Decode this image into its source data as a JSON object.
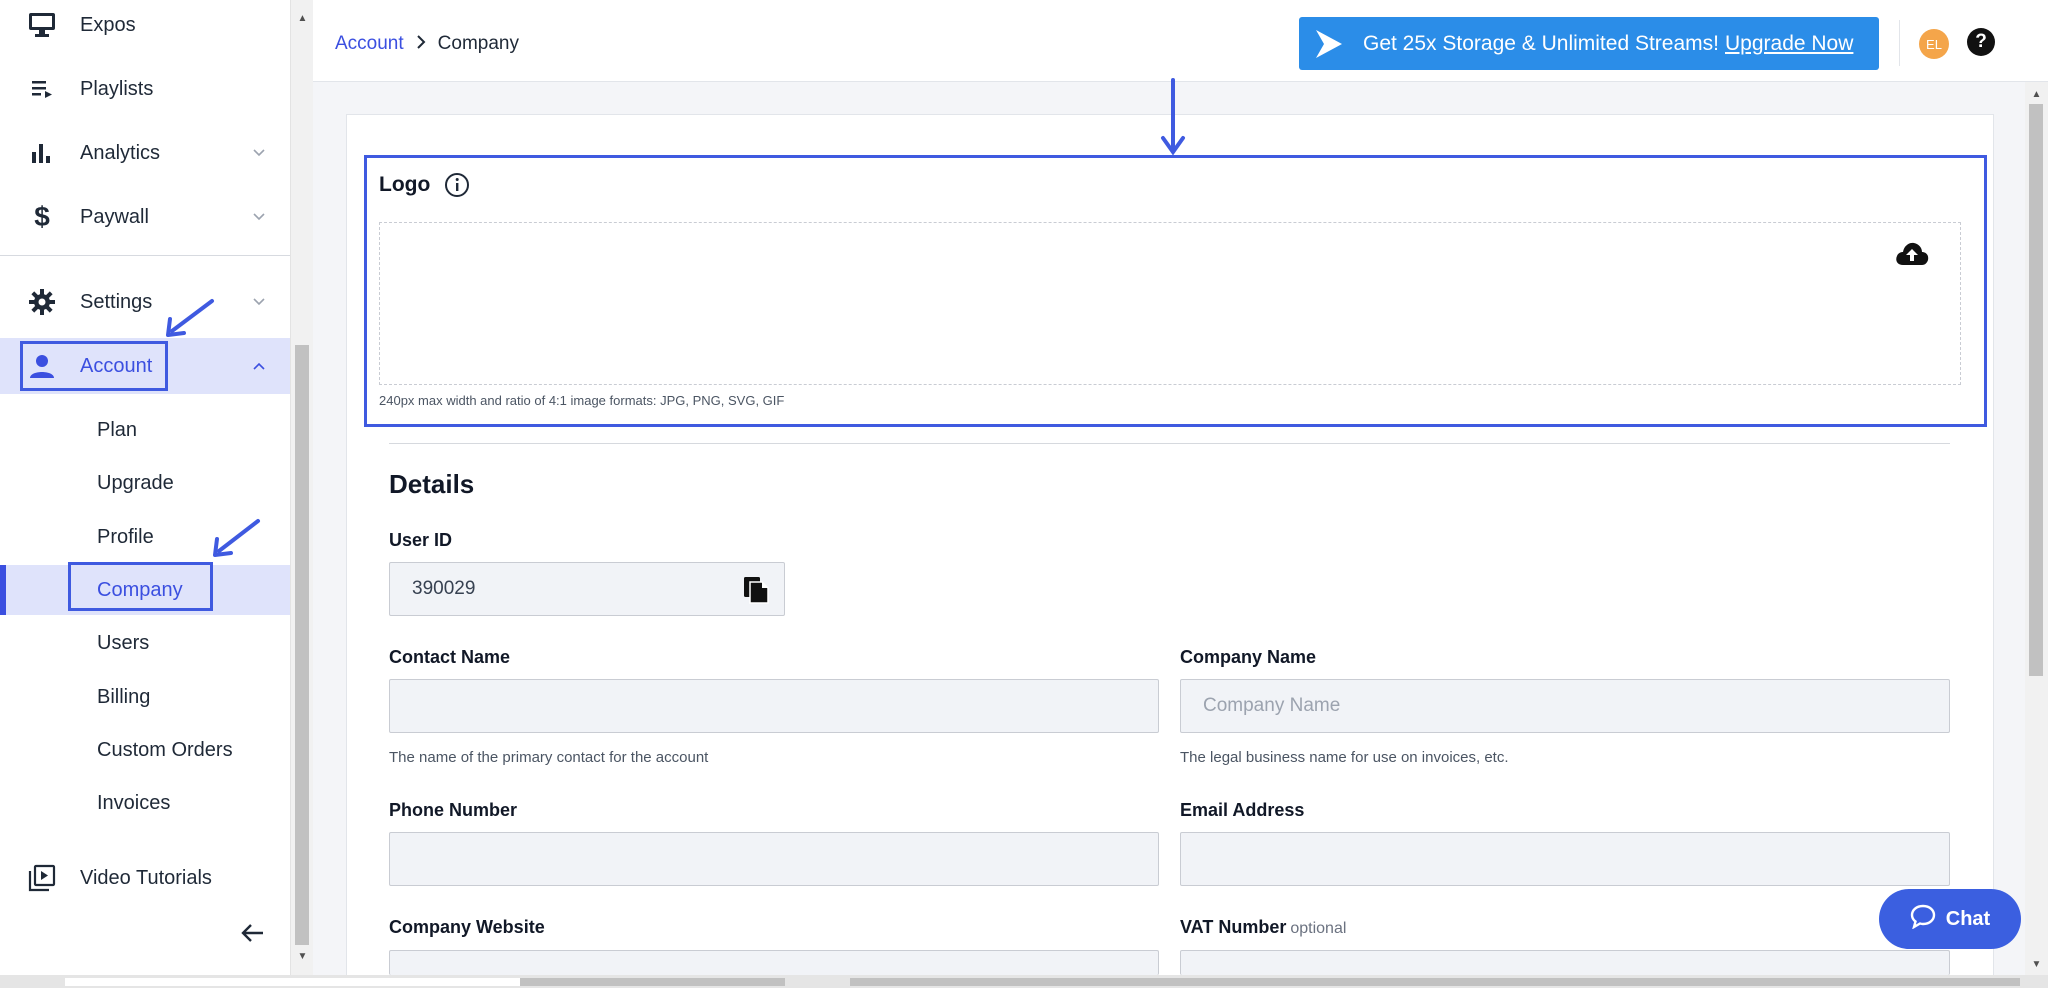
{
  "sidebar": {
    "items": [
      {
        "label": "Expos",
        "icon": "monitor-icon"
      },
      {
        "label": "Playlists",
        "icon": "playlist-icon"
      },
      {
        "label": "Analytics",
        "icon": "bar-chart-icon"
      },
      {
        "label": "Paywall",
        "icon": "dollar-icon"
      },
      {
        "label": "Settings",
        "icon": "gear-icon"
      },
      {
        "label": "Account",
        "icon": "user-icon"
      },
      {
        "label": "Video Tutorials",
        "icon": "video-library-icon"
      }
    ],
    "account_sub": [
      "Plan",
      "Upgrade",
      "Profile",
      "Company",
      "Users",
      "Billing",
      "Custom Orders",
      "Invoices"
    ]
  },
  "header": {
    "breadcrumb_root": "Account",
    "breadcrumb_current": "Company",
    "promo_text": "Get 25x Storage & Unlimited Streams!",
    "promo_cta": "Upgrade Now",
    "avatar_initials": "EL",
    "help_symbol": "?"
  },
  "logo_section": {
    "title": "Logo",
    "hint": "240px max width and ratio of 4:1 image formats: JPG, PNG, SVG, GIF"
  },
  "details": {
    "title": "Details",
    "user_id_label": "User ID",
    "user_id_value": "390029",
    "contact_name_label": "Contact Name",
    "contact_name_value": "",
    "contact_name_help": "The name of the primary contact for the account",
    "company_name_label": "Company Name",
    "company_name_placeholder": "Company Name",
    "company_name_help": "The legal business name for use on invoices, etc.",
    "phone_label": "Phone Number",
    "email_label": "Email Address",
    "website_label": "Company Website",
    "vat_label": "VAT Number",
    "vat_optional": "optional"
  },
  "chat": {
    "label": "Chat"
  },
  "colors": {
    "accent": "#3b4fe0",
    "promo": "#2b8de8",
    "annotation": "#3f5ae0",
    "avatar": "#f4a54a"
  }
}
